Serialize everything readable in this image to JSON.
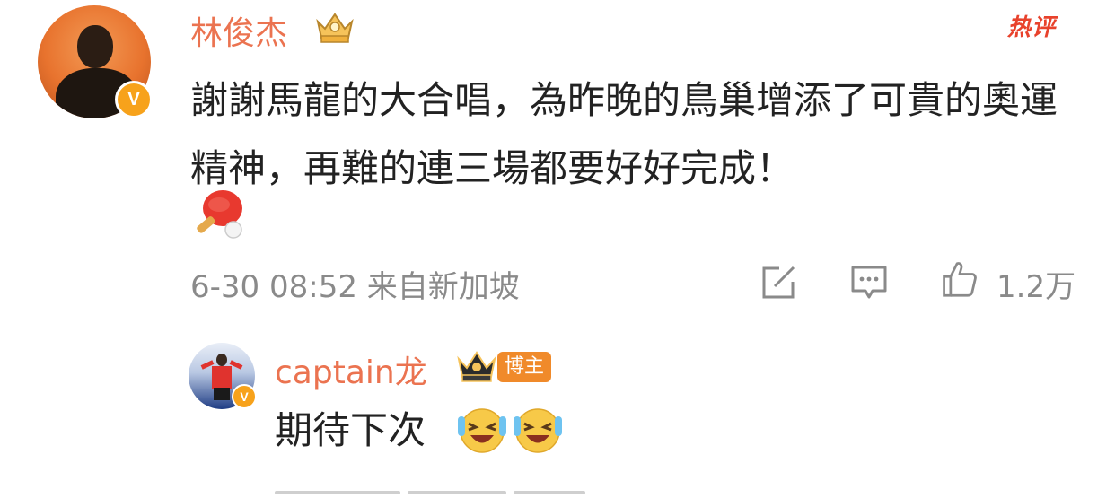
{
  "post": {
    "author": "林俊杰",
    "verified_badge": "V",
    "hot_label": "热评",
    "text": "謝謝馬龍的大合唱，為昨晚的鳥巢增添了可貴的奧運精神，再難的連三場都要好好完成！",
    "emoji": "ping-pong-emoji",
    "date": "6-30 08:52",
    "source": "来自新加坡",
    "like_count": "1.2万"
  },
  "reply": {
    "author": "captain龙",
    "verified_badge": "V",
    "role_tag": "博主",
    "text": "期待下次",
    "emoji": "laugh-cry-emoji"
  },
  "colors": {
    "username": "#eb7350",
    "hot": "#e8422c",
    "meta": "#8a8a8a",
    "badge": "#f7a21b",
    "role_tag": "#f08a2a"
  },
  "icons": [
    "crown-level-icon",
    "hot-comment-icon",
    "repost-icon",
    "comment-icon",
    "like-icon"
  ]
}
